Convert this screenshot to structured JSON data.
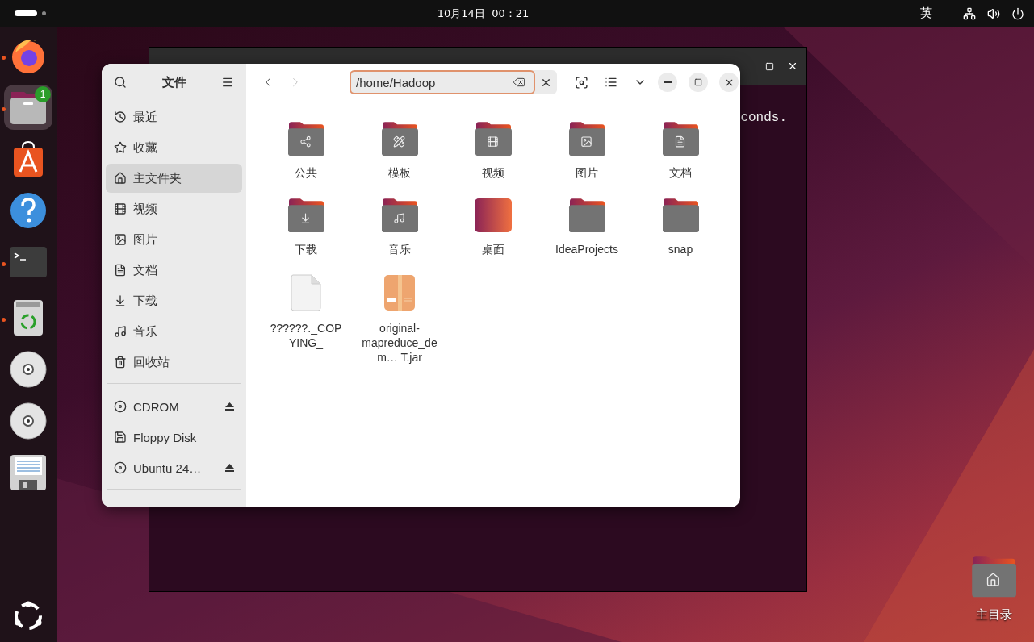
{
  "top_bar": {
    "clock": "10月14日  00：21",
    "input_method": "英"
  },
  "dock": {
    "items": [
      {
        "running": true,
        "selected": false
      },
      {
        "running": true,
        "selected": true,
        "badge": "1"
      },
      {
        "running": false,
        "selected": false
      },
      {
        "running": false,
        "selected": false
      },
      {
        "running": true,
        "selected": false
      },
      {
        "running": true,
        "selected": false
      },
      {
        "running": false,
        "selected": false
      },
      {
        "running": false,
        "selected": false
      },
      {
        "running": false,
        "selected": false
      }
    ]
  },
  "terminal": {
    "output": "conds."
  },
  "files_window": {
    "title": "文件",
    "path": "/home/Hadoop",
    "places": [
      {
        "label": "最近",
        "selected": false
      },
      {
        "label": "收藏",
        "selected": false
      },
      {
        "label": "主文件夹",
        "selected": true
      },
      {
        "label": "视频",
        "selected": false
      },
      {
        "label": "图片",
        "selected": false
      },
      {
        "label": "文档",
        "selected": false
      },
      {
        "label": "下载",
        "selected": false
      },
      {
        "label": "音乐",
        "selected": false
      },
      {
        "label": "回收站",
        "selected": false
      }
    ],
    "devices": [
      {
        "label": "CDROM",
        "ejectable": true
      },
      {
        "label": "Floppy Disk",
        "ejectable": false
      },
      {
        "label": "Ubuntu 24…",
        "ejectable": true
      }
    ],
    "items": [
      {
        "name": "公共",
        "kind": "folder"
      },
      {
        "name": "模板",
        "kind": "folder"
      },
      {
        "name": "视频",
        "kind": "folder"
      },
      {
        "name": "图片",
        "kind": "folder"
      },
      {
        "name": "文档",
        "kind": "folder"
      },
      {
        "name": "下载",
        "kind": "folder"
      },
      {
        "name": "音乐",
        "kind": "folder"
      },
      {
        "name": "桌面",
        "kind": "desktop"
      },
      {
        "name": "IdeaProjects",
        "kind": "folder"
      },
      {
        "name": "snap",
        "kind": "folder"
      },
      {
        "name": "??????._COPYING_",
        "kind": "file"
      },
      {
        "name": "original-mapreduce_dem…  T.jar",
        "kind": "archive"
      }
    ]
  },
  "desktop_icons": [
    {
      "label": "主目录"
    }
  ]
}
